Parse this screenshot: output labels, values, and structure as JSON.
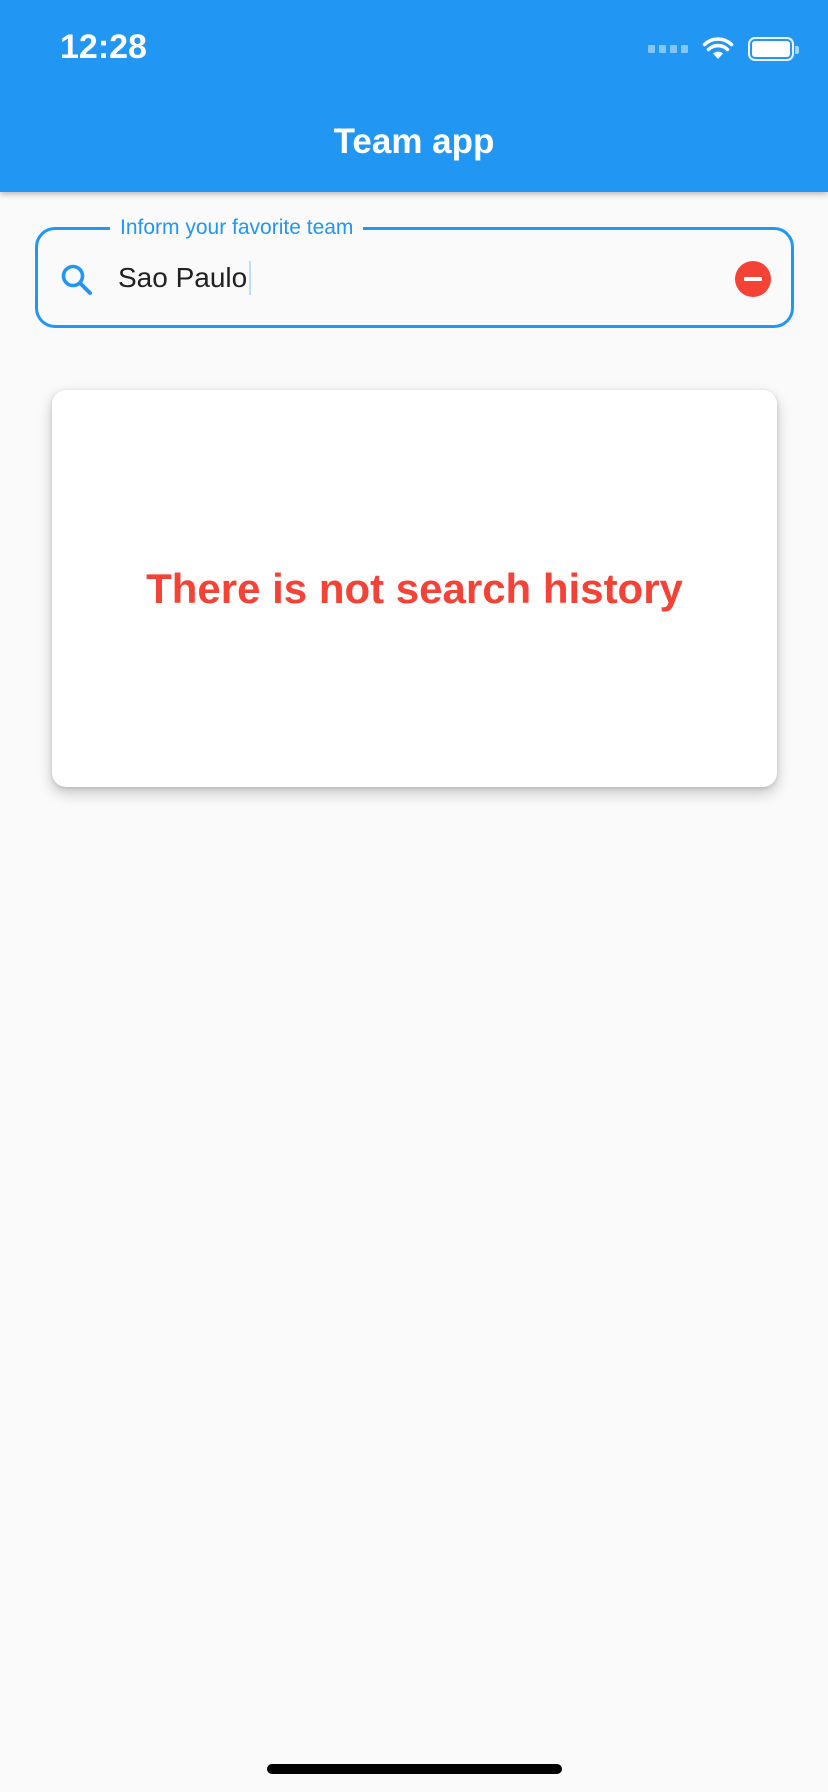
{
  "status_bar": {
    "time": "12:28",
    "icons": [
      "signal-icon",
      "wifi-icon",
      "battery-icon"
    ]
  },
  "app_bar": {
    "title": "Team app",
    "color": "#2196f3"
  },
  "search": {
    "label": "Inform your favorite team",
    "value": "Sao Paulo",
    "icon": "search-icon",
    "clear_icon": "clear-icon",
    "accent_color": "#2196f3",
    "clear_color": "#f44336"
  },
  "history": {
    "empty_message": "There is not search history",
    "message_color": "#f44336"
  }
}
